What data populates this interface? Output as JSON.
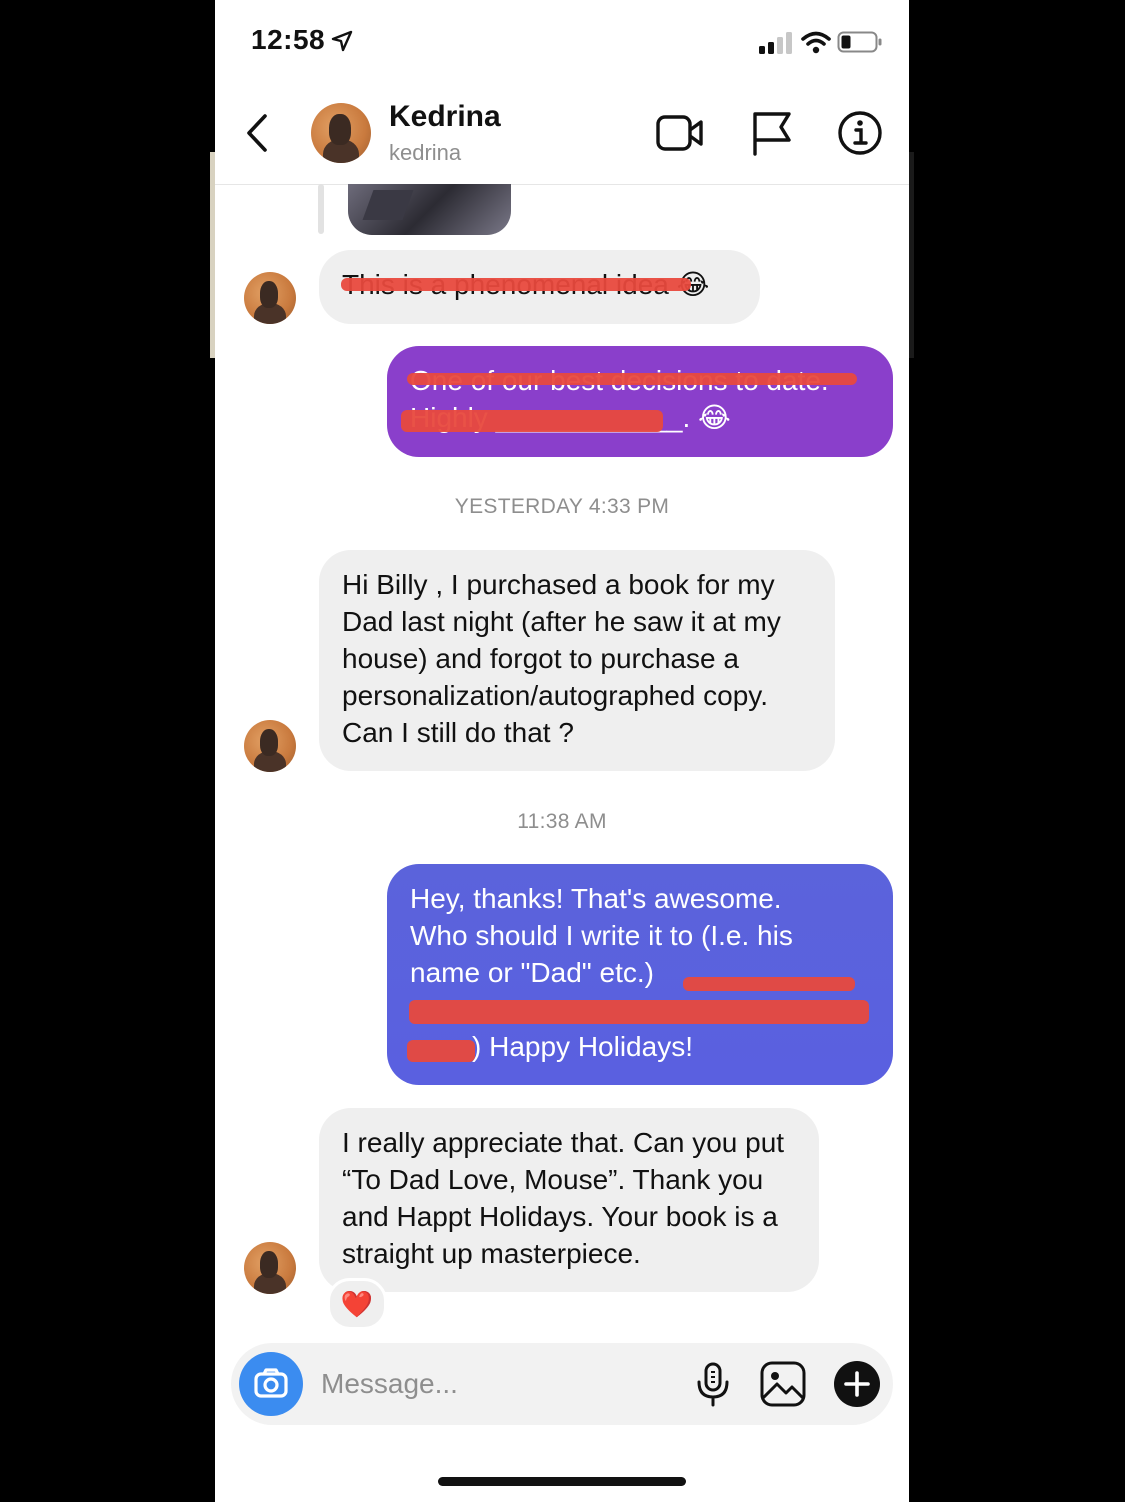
{
  "status_bar": {
    "time": "12:58"
  },
  "header": {
    "name": "Kedrina",
    "username": "kedrina"
  },
  "messages": {
    "m1": {
      "text": "This is a phenomenal idea 😂"
    },
    "m2": {
      "line1": "One of our best decisions to date.",
      "line2": "Highly ____________. 😂"
    },
    "ts1": "YESTERDAY 4:33 PM",
    "m3": {
      "text": "Hi Billy , I purchased a book for my Dad last night (after he saw it at my house) and forgot to purchase a personalization/autographed copy.  Can I still do that ?"
    },
    "ts2": "11:38 AM",
    "m4": {
      "line1": "Hey, thanks! That's awesome.",
      "line2": "Who should I write it to (I.e. his",
      "line3": "name or \"Dad\" etc.)",
      "line4": "",
      "line5": ") Happy Holidays!"
    },
    "m5": {
      "text": "I really appreciate that.  Can you put “To Dad Love, Mouse”. Thank you and Happt Holidays.  Your book is a straight up masterpiece."
    },
    "reaction": "❤️"
  },
  "composer": {
    "placeholder": "Message..."
  },
  "colors": {
    "bubble_out_top": "#8f3fc9",
    "bubble_out_bottom": "#5a5fe0",
    "bubble_in": "#efefef",
    "camera_blue": "#3b8cf0",
    "redaction": "#e8493d"
  }
}
